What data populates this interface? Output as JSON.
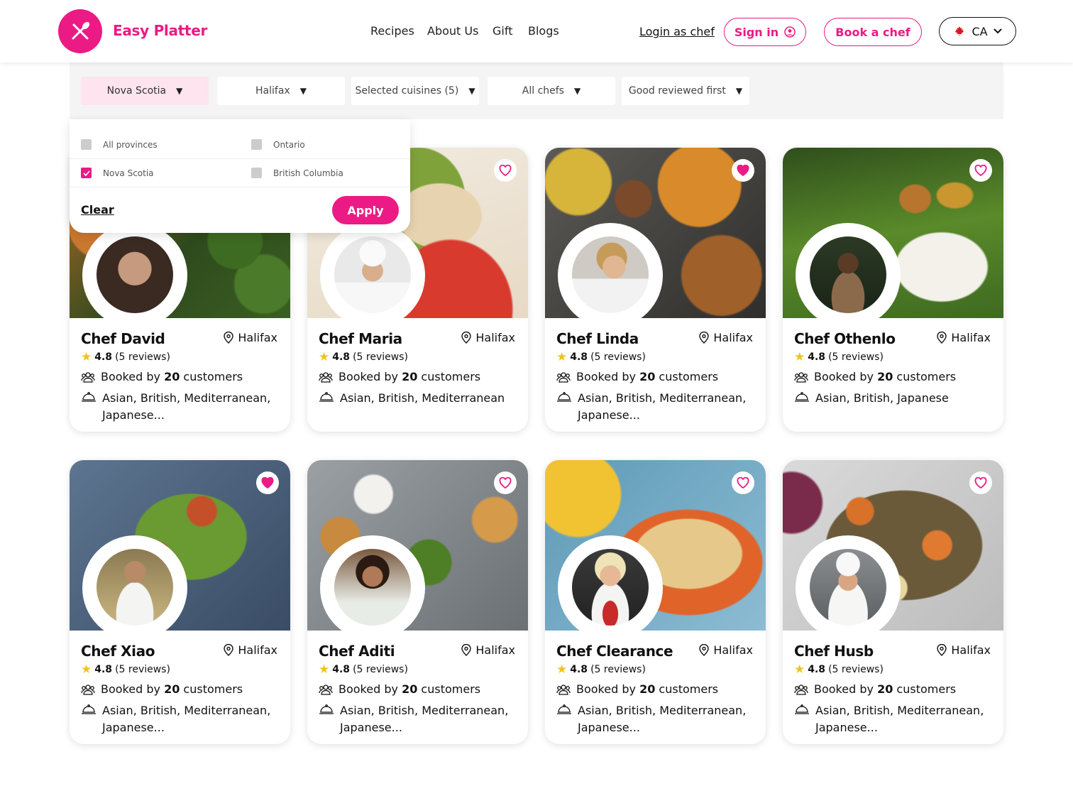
{
  "brand": {
    "name": "Easy Platter",
    "accent": "#ec1a84"
  },
  "nav": {
    "items": [
      "Recipes",
      "About Us",
      "Gift",
      "Blogs"
    ]
  },
  "header": {
    "login_label": "Login as chef",
    "sign_in_label": "Sign in",
    "book_label": "Book a chef",
    "country_label": "CA"
  },
  "filters": [
    {
      "label": "Nova Scotia",
      "active": true
    },
    {
      "label": "Halifax"
    },
    {
      "label": "Selected cuisines (5)"
    },
    {
      "label": "All chefs"
    },
    {
      "label": "Good reviewed first"
    }
  ],
  "province_dropdown": {
    "options": [
      {
        "label": "All provinces",
        "checked": false
      },
      {
        "label": "Ontario",
        "checked": false
      },
      {
        "label": "Nova Scotia",
        "checked": true
      },
      {
        "label": "British Columbia",
        "checked": false
      }
    ],
    "clear_label": "Clear",
    "apply_label": "Apply"
  },
  "chefs": [
    {
      "name": "Chef David",
      "location": "Halifax",
      "rating": "4.8",
      "reviews": "(5 reviews)",
      "booked_prefix": "Booked by",
      "booked_count": "20",
      "booked_suffix": "customers",
      "cuisines": "Asian, British, Mediterranean, Japanese...",
      "favorited": false
    },
    {
      "name": "Chef Maria",
      "location": "Halifax",
      "rating": "4.8",
      "reviews": "(5 reviews)",
      "booked_prefix": "Booked by",
      "booked_count": "20",
      "booked_suffix": "customers",
      "cuisines": "Asian, British, Mediterranean",
      "favorited": false
    },
    {
      "name": "Chef Linda",
      "location": "Halifax",
      "rating": "4.8",
      "reviews": "(5 reviews)",
      "booked_prefix": "Booked by",
      "booked_count": "20",
      "booked_suffix": "customers",
      "cuisines": "Asian, British, Mediterranean, Japanese...",
      "favorited": true
    },
    {
      "name": "Chef Othenlo",
      "location": "Halifax",
      "rating": "4.8",
      "reviews": "(5 reviews)",
      "booked_prefix": "Booked by",
      "booked_count": "20",
      "booked_suffix": "customers",
      "cuisines": "Asian, British, Japanese",
      "favorited": false
    },
    {
      "name": "Chef Xiao",
      "location": "Halifax",
      "rating": "4.8",
      "reviews": "(5 reviews)",
      "booked_prefix": "Booked by",
      "booked_count": "20",
      "booked_suffix": "customers",
      "cuisines": "Asian, British, Mediterranean, Japanese...",
      "favorited": true
    },
    {
      "name": "Chef Aditi",
      "location": "Halifax",
      "rating": "4.8",
      "reviews": "(5 reviews)",
      "booked_prefix": "Booked by",
      "booked_count": "20",
      "booked_suffix": "customers",
      "cuisines": "Asian, British, Mediterranean, Japanese...",
      "favorited": false
    },
    {
      "name": "Chef Clearance",
      "location": "Halifax",
      "rating": "4.8",
      "reviews": "(5 reviews)",
      "booked_prefix": "Booked by",
      "booked_count": "20",
      "booked_suffix": "customers",
      "cuisines": "Asian, British, Mediterranean, Japanese...",
      "favorited": false
    },
    {
      "name": "Chef Husb",
      "location": "Halifax",
      "rating": "4.8",
      "reviews": "(5 reviews)",
      "booked_prefix": "Booked by",
      "booked_count": "20",
      "booked_suffix": "customers",
      "cuisines": "Asian, British, Mediterranean, Japanese...",
      "favorited": false
    }
  ]
}
